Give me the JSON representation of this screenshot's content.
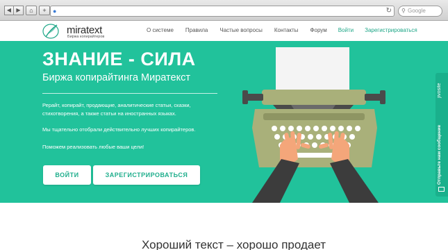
{
  "browser": {
    "back_glyph": "◀",
    "forward_glyph": "▶",
    "home_glyph": "⌂",
    "plus_glyph": "+",
    "reload_glyph": "↻",
    "search_placeholder": "Google",
    "icons": [
      "back-icon",
      "forward-icon",
      "home-icon",
      "add-tab-icon",
      "globe-icon",
      "reload-icon",
      "search-icon"
    ]
  },
  "header": {
    "logo_text": "miratext",
    "logo_subtitle": "Биржа копирайтеров",
    "nav": [
      {
        "label": "О системе"
      },
      {
        "label": "Правила"
      },
      {
        "label": "Частые вопросы"
      },
      {
        "label": "Контакты"
      },
      {
        "label": "Форум"
      },
      {
        "label": "Войти"
      },
      {
        "label": "Зарегистрироваться"
      }
    ]
  },
  "hero": {
    "title": "ЗНАНИЕ - СИЛА",
    "subtitle": "Биржа копирайтинга Миратекст",
    "paragraph1": "Рерайт, копирайт, продающие, аналитические статьи, сказки, стихотворения, а также статьи на иностранных языках.",
    "paragraph2": "Мы тщательно отобрали действительно лучших копирайтеров.",
    "paragraph3": "Поможем реализовать любые ваши цели!",
    "login_button": "ВОЙТИ",
    "register_button": "ЗАРЕГИСТРИРОВАТЬСЯ"
  },
  "side_widget": {
    "brand": "jivosite",
    "label": "Отправьте нам сообщение"
  },
  "section": {
    "title": "Хороший текст – хорошо продает"
  },
  "colors": {
    "accent": "#21c29b",
    "link": "#1fa788",
    "typewriter_body": "#a9b07a",
    "hands": "#f4a67a",
    "sleeves": "#3c3c3c"
  }
}
